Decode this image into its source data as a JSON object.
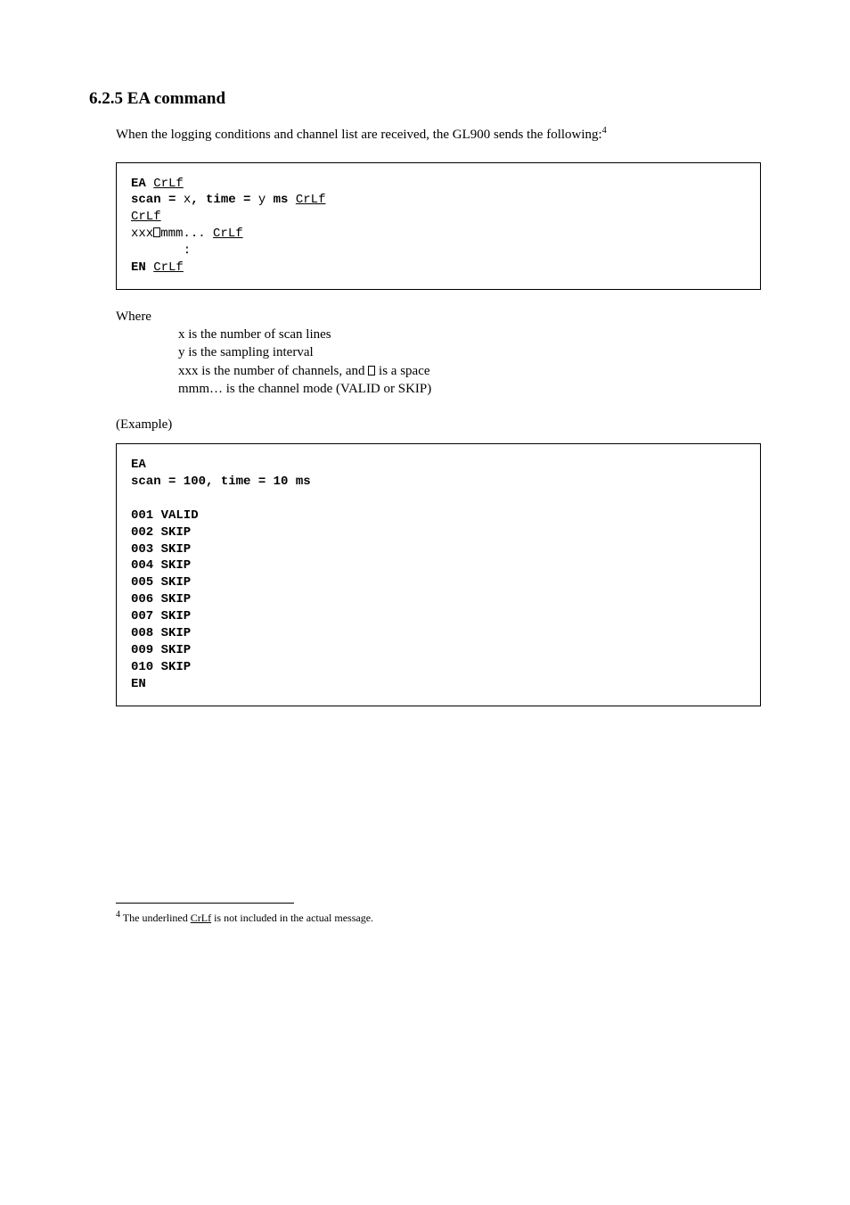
{
  "heading": "6.2.5 EA command",
  "intro_paragraph": "When the logging conditions and channel list are received, the GL900 sends the following:",
  "code1": {
    "l1_b": "EA ",
    "l1_u": "CrLf",
    "l2_b1": "scan = ",
    "l2_x": "x",
    "l2_b2": ", ",
    "l2_b3": "time = ",
    "l2_y": "y",
    "l2_b4": " ms ",
    "l2_u": "CrLf",
    "l3_u": "CrLf",
    "l4_xxx": "xxx",
    "l4_mmm": "mmm... ",
    "l4_u": "CrLf",
    "l5_colon": "       :",
    "l6_b": "EN ",
    "l6_u": "CrLf"
  },
  "where_label": "Where",
  "where_lines": {
    "l1": "x is the number of scan lines",
    "l2": "y is the sampling interval",
    "l3a": "xxx is the number of channels, and ",
    "l3b": " is a space",
    "l4": "mmm… is the channel mode (VALID or SKIP)"
  },
  "example_label": "(Example)",
  "example_block": "EA\nscan = 100, time = 10 ms\n\n001 VALID\n002 SKIP\n003 SKIP\n004 SKIP\n005 SKIP\n006 SKIP\n007 SKIP\n008 SKIP\n009 SKIP\n010 SKIP\nEN",
  "footnote_marker": "4",
  "footnote_prefix": " The underlined ",
  "footnote_u": "CrLf",
  "footnote_suffix": " is not included in the actual message."
}
